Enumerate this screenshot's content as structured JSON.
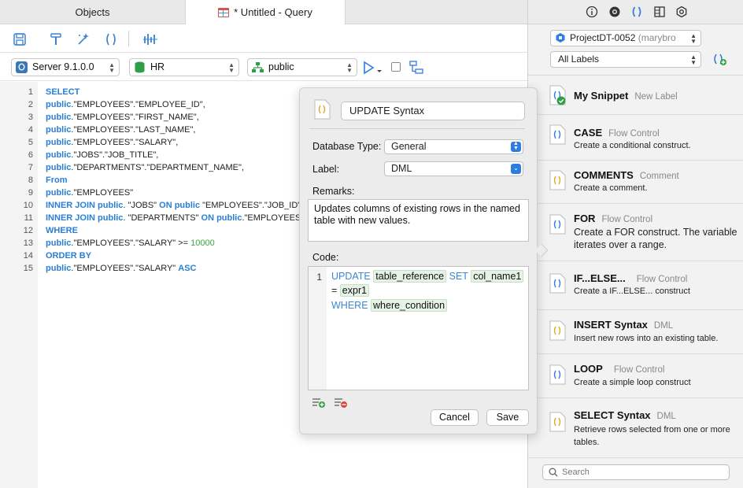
{
  "tabs": [
    {
      "label": "Objects"
    },
    {
      "label": "* Untitled - Query"
    }
  ],
  "toolbar": {
    "server": "Server 9.1.0.0",
    "database": "HR",
    "schema": "public"
  },
  "editor": {
    "line_numbers": [
      "1",
      "2",
      "3",
      "4",
      "5",
      "6",
      "7",
      "8",
      "9",
      "10",
      "11",
      "12",
      "13",
      "14",
      "15"
    ],
    "tokens": {
      "select": "SELECT",
      "public": "public",
      "l2": ".\"EMPLOYEES\".\"EMPLOYEE_ID\",",
      "l3": ".\"EMPLOYEES\".\"FIRST_NAME\",",
      "l4": ".\"EMPLOYEES\".\"LAST_NAME\",",
      "l5": ".\"EMPLOYEES\".\"SALARY\",",
      "l6": ".\"JOBS\".\"JOB_TITLE\",",
      "l7": ".\"DEPARTMENTS\".\"DEPARTMENT_NAME\",",
      "from": "From",
      "l9": ".\"EMPLOYEES\"",
      "inner_join": "INNER JOIN",
      "l10a": ". \"JOBS\" ",
      "on": "ON",
      "l10b": " \"EMPLOYEES\".\"JOB_ID\"",
      "l11a": ". \"DEPARTMENTS\" ",
      "l11b": ".\"EMPLOYEES",
      "where": "WHERE",
      "l13": ".\"EMPLOYEES\".\"SALARY\" >= ",
      "l13num": "10000",
      "order_by": "ORDER BY",
      "l15": ".\"EMPLOYEES\".\"SALARY\" ",
      "asc": "ASC"
    }
  },
  "popover": {
    "title": "UPDATE Syntax",
    "database_type_label": "Database Type:",
    "database_type_value": "General",
    "label_label": "Label:",
    "label_value": "DML",
    "remarks_label": "Remarks:",
    "remarks_text": "Updates columns of existing rows in the named table with new values.",
    "code_label": "Code:",
    "code_line_number": "1",
    "code": {
      "kw_update": "UPDATE",
      "ph_table": "table_reference",
      "kw_set": "SET",
      "ph_col": "col_name1",
      "eq": "=",
      "ph_expr": "expr1",
      "kw_where": "WHERE",
      "ph_where": "where_condition"
    },
    "cancel_label": "Cancel",
    "save_label": "Save"
  },
  "right_panel": {
    "project_name": "ProjectDT-0052",
    "project_owner": " (marybro",
    "labels_filter": "All Labels",
    "snippets": [
      {
        "title": "My Snippet",
        "label": "New Label",
        "desc": ""
      },
      {
        "title": "CASE",
        "label": "Flow Control",
        "desc": "Create a conditional construct."
      },
      {
        "title": "COMMENTS",
        "label": "Comment",
        "desc": "Create a comment."
      },
      {
        "title": "FOR",
        "label": "Flow Control",
        "desc": "Create a FOR construct. The variable iterates over a range."
      },
      {
        "title": "IF...ELSE...",
        "label": "Flow Control",
        "desc": "Create a IF...ELSE... construct"
      },
      {
        "title": "INSERT Syntax",
        "label": "DML",
        "desc": "Insert new rows into an existing table."
      },
      {
        "title": "LOOP",
        "label": "Flow Control",
        "desc": "Create a simple loop construct"
      },
      {
        "title": "SELECT Syntax",
        "label": "DML",
        "desc": "Retrieve rows selected from one or more tables."
      }
    ],
    "search_placeholder": "Search"
  }
}
